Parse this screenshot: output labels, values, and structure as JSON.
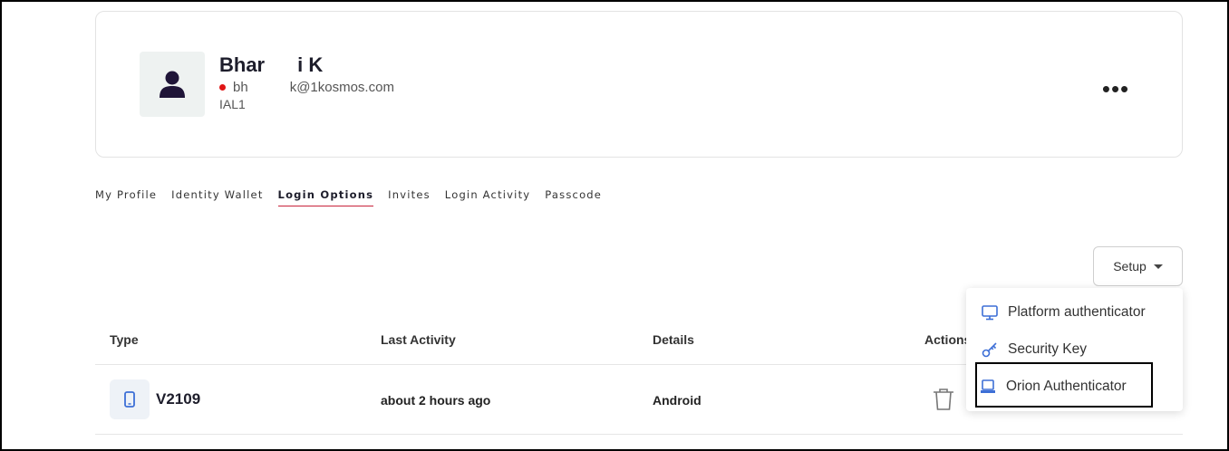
{
  "profile": {
    "name": "Bhar",
    "name_suffix": "i K",
    "email_prefix": "bh",
    "email_suffix": "k@1kosmos.com",
    "level": "IAL1",
    "more_label": "•••"
  },
  "tabs": [
    {
      "label": "My Profile"
    },
    {
      "label": "Identity Wallet"
    },
    {
      "label": "Login Options"
    },
    {
      "label": "Invites"
    },
    {
      "label": "Login Activity"
    },
    {
      "label": "Passcode"
    }
  ],
  "setup": {
    "label": "Setup"
  },
  "table": {
    "headers": [
      "Type",
      "Last Activity",
      "Details",
      "Actions"
    ],
    "rows": [
      {
        "type": "V2109",
        "last_activity": "about 2 hours ago",
        "details": "Android"
      }
    ]
  },
  "setup_menu": {
    "items": [
      {
        "label": "Platform authenticator",
        "icon": "monitor-icon"
      },
      {
        "label": "Security Key",
        "icon": "key-icon"
      },
      {
        "label": "Orion Authenticator",
        "icon": "laptop-icon"
      }
    ]
  },
  "colors": {
    "accent_tab_underline": "#c8233a",
    "status_dot": "#e01515",
    "menu_icon": "#3d6fd6",
    "avatar_icon": "#1f1538"
  }
}
